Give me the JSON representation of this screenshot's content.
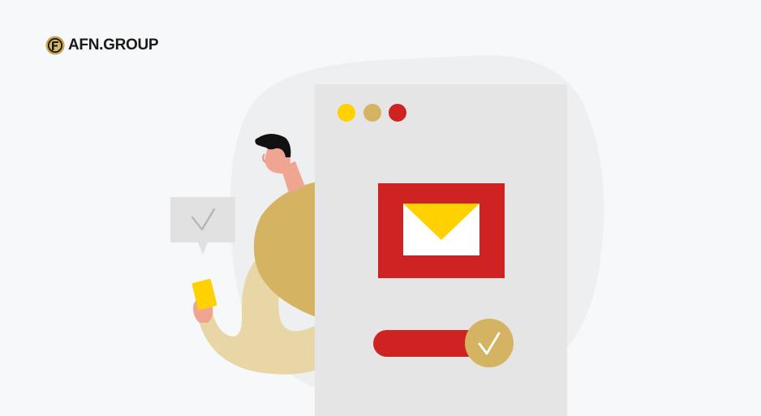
{
  "brand": {
    "name": "AFN.GROUP",
    "logo_icon": "afn-emblem-icon"
  },
  "illustration": {
    "subject": "email-confirmed",
    "icons": [
      "envelope-icon",
      "checkmark-icon",
      "speech-bubble-check-icon",
      "phone-icon"
    ],
    "window_dots": [
      "#ffd100",
      "#d4b463",
      "#cf2222"
    ],
    "colors": {
      "accent_gold": "#d4b463",
      "accent_red": "#cf2222",
      "accent_yellow": "#ffd100",
      "panel_gray": "#e5e5e5",
      "background": "#f7f8f9"
    }
  }
}
